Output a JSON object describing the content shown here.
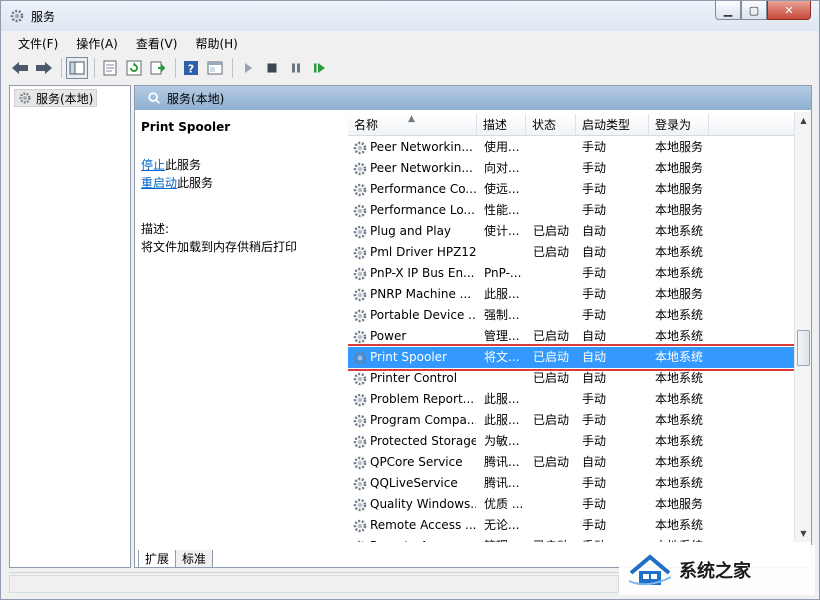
{
  "window": {
    "title": "服务"
  },
  "menu": [
    {
      "label": "文件(F)"
    },
    {
      "label": "操作(A)"
    },
    {
      "label": "查看(V)"
    },
    {
      "label": "帮助(H)"
    }
  ],
  "toolbar_icons": [
    "back-icon",
    "forward-icon",
    "show-tree-icon",
    "properties-icon",
    "refresh-icon",
    "export-icon",
    "help-icon",
    "console-icon",
    "start-service-icon",
    "stop-service-icon",
    "pause-service-icon",
    "restart-service-icon"
  ],
  "tree": {
    "root": "服务(本地)"
  },
  "main": {
    "header": "服务(本地)",
    "selected_title": "Print Spooler",
    "action_stop_link": "停止",
    "action_stop_suffix": "此服务",
    "action_restart_link": "重启动",
    "action_restart_suffix": "此服务",
    "desc_label": "描述:",
    "desc_text": "将文件加载到内存供稍后打印"
  },
  "columns": {
    "name": "名称",
    "desc": "描述",
    "status": "状态",
    "startup": "启动类型",
    "logon": "登录为"
  },
  "services": [
    {
      "name": "Peer Networkin...",
      "desc": "使用...",
      "status": "",
      "startup": "手动",
      "logon": "本地服务"
    },
    {
      "name": "Peer Networkin...",
      "desc": "向对...",
      "status": "",
      "startup": "手动",
      "logon": "本地服务"
    },
    {
      "name": "Performance Co...",
      "desc": "使远...",
      "status": "",
      "startup": "手动",
      "logon": "本地服务"
    },
    {
      "name": "Performance Lo...",
      "desc": "性能...",
      "status": "",
      "startup": "手动",
      "logon": "本地服务"
    },
    {
      "name": "Plug and Play",
      "desc": "使计...",
      "status": "已启动",
      "startup": "自动",
      "logon": "本地系统"
    },
    {
      "name": "Pml Driver HPZ12",
      "desc": "",
      "status": "已启动",
      "startup": "自动",
      "logon": "本地系统"
    },
    {
      "name": "PnP-X IP Bus En...",
      "desc": "PnP-...",
      "status": "",
      "startup": "手动",
      "logon": "本地系统"
    },
    {
      "name": "PNRP Machine ...",
      "desc": "此服...",
      "status": "",
      "startup": "手动",
      "logon": "本地服务"
    },
    {
      "name": "Portable Device ...",
      "desc": "强制...",
      "status": "",
      "startup": "手动",
      "logon": "本地系统"
    },
    {
      "name": "Power",
      "desc": "管理...",
      "status": "已启动",
      "startup": "自动",
      "logon": "本地系统"
    },
    {
      "name": "Print Spooler",
      "desc": "将文...",
      "status": "已启动",
      "startup": "自动",
      "logon": "本地系统"
    },
    {
      "name": "Printer Control",
      "desc": "",
      "status": "已启动",
      "startup": "自动",
      "logon": "本地系统"
    },
    {
      "name": "Problem Report...",
      "desc": "此服...",
      "status": "",
      "startup": "手动",
      "logon": "本地系统"
    },
    {
      "name": "Program Compa...",
      "desc": "此服...",
      "status": "已启动",
      "startup": "手动",
      "logon": "本地系统"
    },
    {
      "name": "Protected Storage",
      "desc": "为敏...",
      "status": "",
      "startup": "手动",
      "logon": "本地系统"
    },
    {
      "name": "QPCore Service",
      "desc": "腾讯...",
      "status": "已启动",
      "startup": "自动",
      "logon": "本地系统"
    },
    {
      "name": "QQLiveService",
      "desc": "腾讯...",
      "status": "",
      "startup": "手动",
      "logon": "本地系统"
    },
    {
      "name": "Quality Windows...",
      "desc": "优质 ...",
      "status": "",
      "startup": "手动",
      "logon": "本地服务"
    },
    {
      "name": "Remote Access ...",
      "desc": "无论...",
      "status": "",
      "startup": "手动",
      "logon": "本地系统"
    },
    {
      "name": "Remote Access ...",
      "desc": "管理...",
      "status": "已启动",
      "startup": "手动",
      "logon": "本地系统"
    }
  ],
  "selected_index": 10,
  "tabs": [
    {
      "label": "扩展"
    },
    {
      "label": "标准"
    }
  ],
  "watermark": {
    "text": "系统之家"
  },
  "colors": {
    "selection": "#3399ff",
    "highlight_box": "#d83b3b",
    "link": "#0066cc",
    "header_blue": "#a3bfdc"
  }
}
